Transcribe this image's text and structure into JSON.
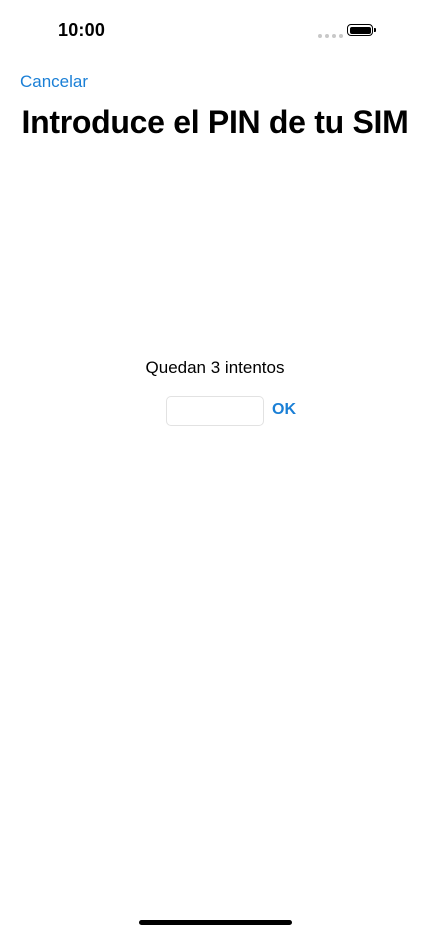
{
  "status_bar": {
    "time": "10:00",
    "signal_icon": "signal-dots-icon",
    "battery_icon": "battery-icon",
    "battery_level": 1.0
  },
  "nav": {
    "cancel_label": "Cancelar"
  },
  "header": {
    "title": "Introduce el PIN de tu SIM"
  },
  "form": {
    "attempts_text": "Quedan 3 intentos",
    "pin_value": "",
    "pin_placeholder": "",
    "ok_label": "OK"
  },
  "colors": {
    "accent": "#1a7fd6",
    "text": "#000000",
    "background": "#ffffff",
    "input_border": "#e2e2e2"
  }
}
